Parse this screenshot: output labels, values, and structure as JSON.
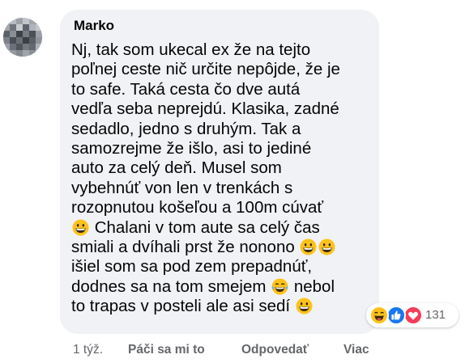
{
  "comment": {
    "author": "Marko",
    "lines": [
      {
        "text": "Nj, tak som ukecal ex že na tejto"
      },
      {
        "text": "poľnej ceste nič určite nepôjde, že je"
      },
      {
        "text": "to safe. Taká cesta čo dve autá"
      },
      {
        "text": "vedľa seba neprejdú. Klasika, zadné"
      },
      {
        "text": "sedadlo, jedno s druhým. Tak a"
      },
      {
        "text": "samozrejme že išlo, asi to jediné"
      },
      {
        "text": "auto za celý deň. Musel som"
      },
      {
        "text": "vybehnúť von len v trenkách s"
      },
      {
        "text": "rozopnutou košeľou a 100m cúvať"
      },
      {
        "pre": "",
        "text": "Chalani v tom aute sa celý čas"
      },
      {
        "text": "smiali a dvíhali prst že nonono"
      },
      {
        "text": "išiel som sa pod zem prepadnúť,"
      },
      {
        "text": "dodnes sa na tom smejem",
        "post": "nebol"
      },
      {
        "text": "to trapas v posteli ale asi sedí"
      }
    ],
    "emoji_names": [
      "grinning-face-emoji",
      "tears-of-joy-emoji"
    ],
    "reactions": {
      "icons": [
        "haha-reaction-icon",
        "like-reaction-icon",
        "love-reaction-icon"
      ],
      "count": "131"
    }
  },
  "footer": {
    "time": "1 týž.",
    "like": "Páči sa mi to",
    "reply": "Odpovedať",
    "more": "Viac"
  },
  "colors": {
    "bubble": "#f0f2f5",
    "text": "#050505",
    "meta": "#65676b",
    "like_blue": "#1877f2",
    "love_red": "#f33e58",
    "emoji_yellow": "#fcc21b"
  }
}
